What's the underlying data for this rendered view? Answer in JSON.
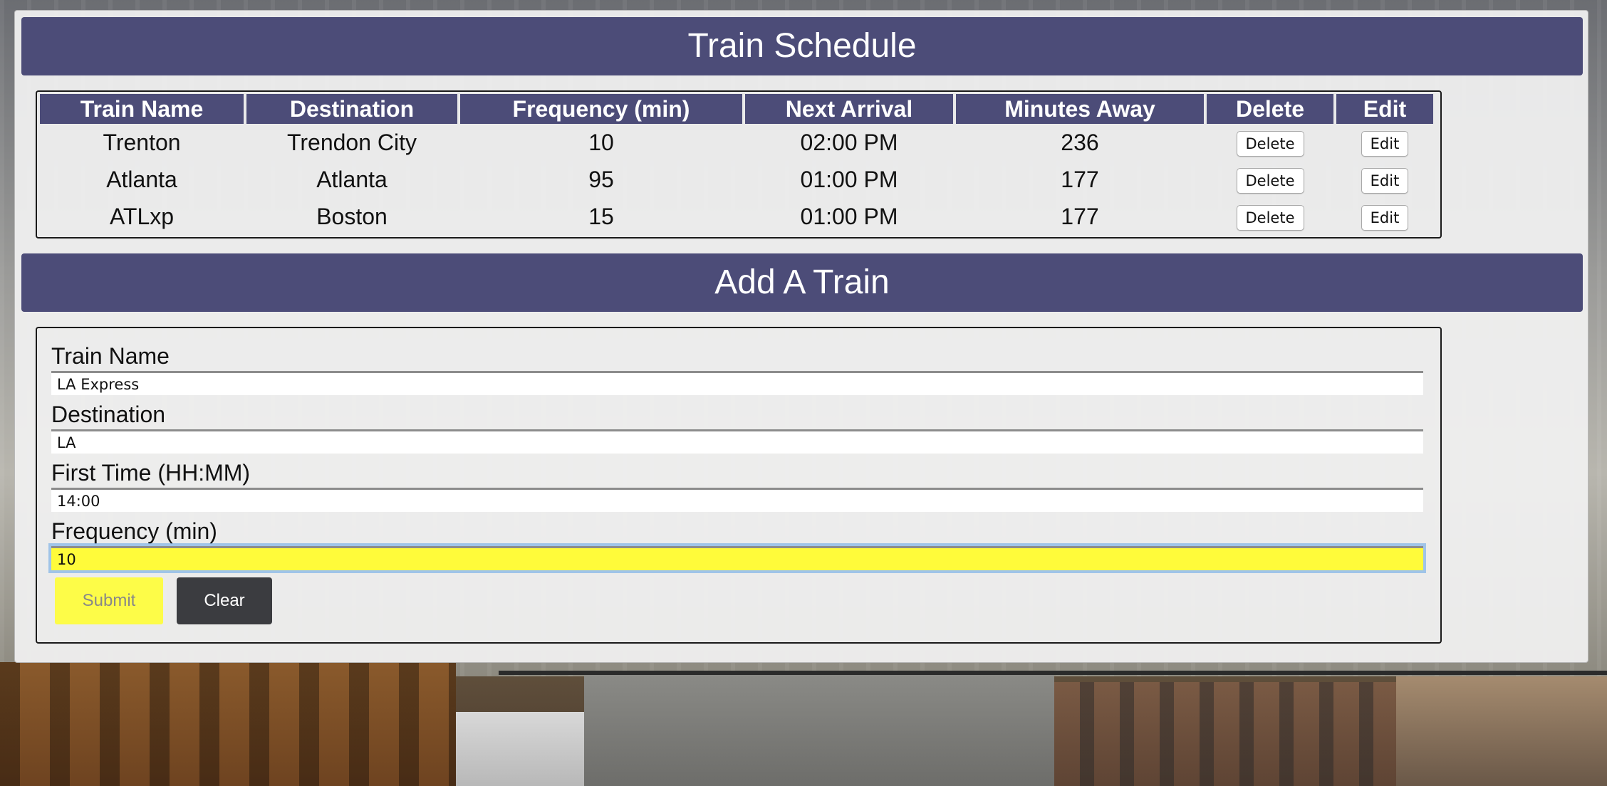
{
  "schedule": {
    "title": "Train Schedule",
    "columns": [
      "Train Name",
      "Destination",
      "Frequency (min)",
      "Next Arrival",
      "Minutes Away",
      "Delete",
      "Edit"
    ],
    "rows": [
      {
        "name": "Trenton",
        "destination": "Trendon City",
        "frequency": "10",
        "next_arrival": "02:00 PM",
        "minutes_away": "236",
        "delete_label": "Delete",
        "edit_label": "Edit"
      },
      {
        "name": "Atlanta",
        "destination": "Atlanta",
        "frequency": "95",
        "next_arrival": "01:00 PM",
        "minutes_away": "177",
        "delete_label": "Delete",
        "edit_label": "Edit"
      },
      {
        "name": "ATLxp",
        "destination": "Boston",
        "frequency": "15",
        "next_arrival": "01:00 PM",
        "minutes_away": "177",
        "delete_label": "Delete",
        "edit_label": "Edit"
      }
    ]
  },
  "form": {
    "title": "Add A Train",
    "train_name": {
      "label": "Train Name",
      "value": "LA Express"
    },
    "destination": {
      "label": "Destination",
      "value": "LA"
    },
    "first_time": {
      "label": "First Time (HH:MM)",
      "value": "14:00"
    },
    "frequency": {
      "label": "Frequency (min)",
      "value": "10"
    },
    "submit_label": "Submit",
    "clear_label": "Clear"
  },
  "colors": {
    "banner": "#4c4c78",
    "focused_input": "#fffb3a",
    "submit_button": "#fdfc48",
    "clear_button": "#3b3c40"
  }
}
